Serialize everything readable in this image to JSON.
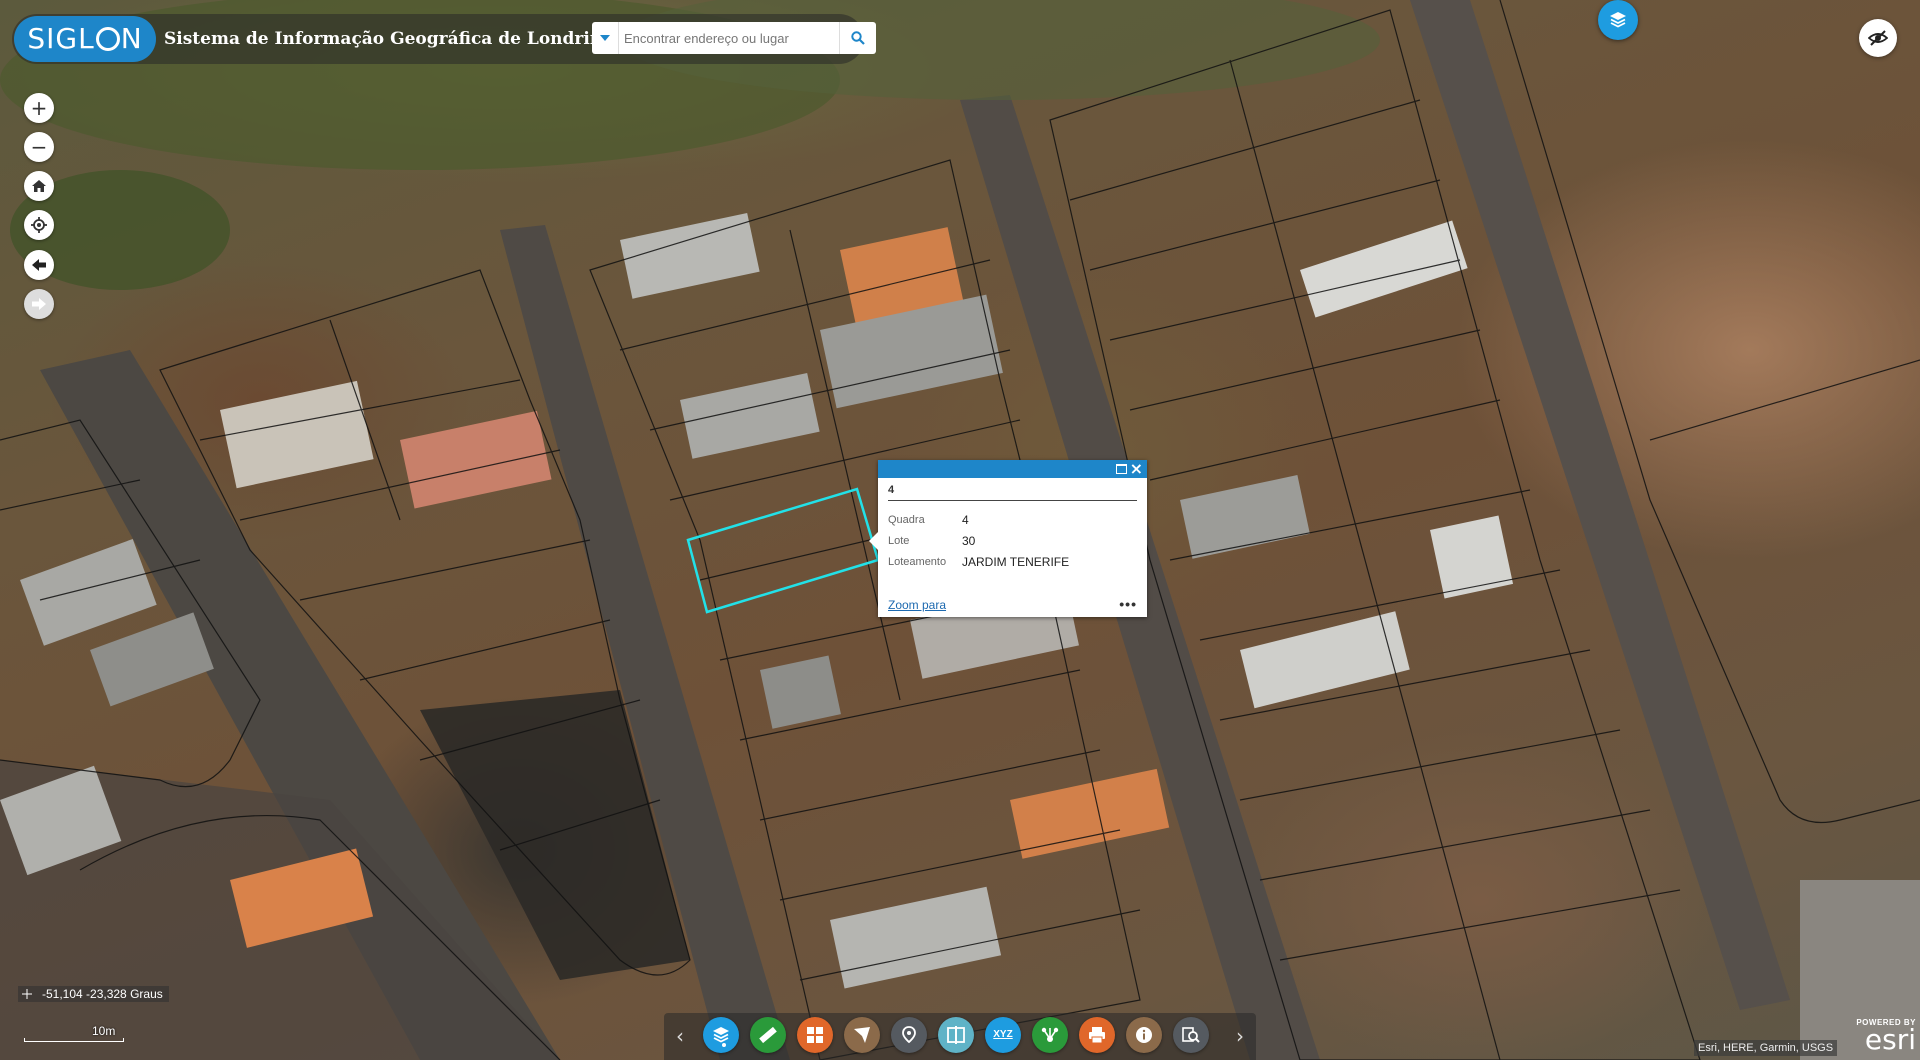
{
  "header": {
    "logo_text": "SIGLON",
    "title": "Sistema de Informação Geográfica de Londrina",
    "search_placeholder": "Encontrar endereço ou lugar"
  },
  "controls": {
    "zoom_in": "+",
    "zoom_out": "−"
  },
  "popup": {
    "title": "4",
    "fields": [
      {
        "key": "Quadra",
        "value": "4"
      },
      {
        "key": "Lote",
        "value": "30"
      },
      {
        "key": "Loteamento",
        "value": "JARDIM TENERIFE"
      }
    ],
    "zoom_label": "Zoom para",
    "more_label": "•••"
  },
  "status": {
    "coordinates": "-51,104 -23,328 Graus",
    "scale_label": "10m"
  },
  "attribution": "Esri, HERE, Garmin, USGS",
  "esri": {
    "powered_by": "POWERED BY",
    "name": "esri"
  },
  "toolbar": {
    "tools": [
      {
        "name": "layers",
        "color": "#1e9ce0"
      },
      {
        "name": "measure",
        "color": "#2a9a3a"
      },
      {
        "name": "basemap-gallery",
        "color": "#e0672a"
      },
      {
        "name": "filter",
        "color": "#8b6a4a"
      },
      {
        "name": "geolocate",
        "color": "#555a60"
      },
      {
        "name": "swipe",
        "color": "#5fb3c7"
      },
      {
        "name": "coordinates-xyz",
        "color": "#1e9ce0"
      },
      {
        "name": "share",
        "color": "#2a9a3a"
      },
      {
        "name": "print",
        "color": "#e0672a"
      },
      {
        "name": "about",
        "color": "#8b6a4a"
      },
      {
        "name": "query",
        "color": "#555a60"
      }
    ],
    "xyz_label": "XYZ"
  }
}
